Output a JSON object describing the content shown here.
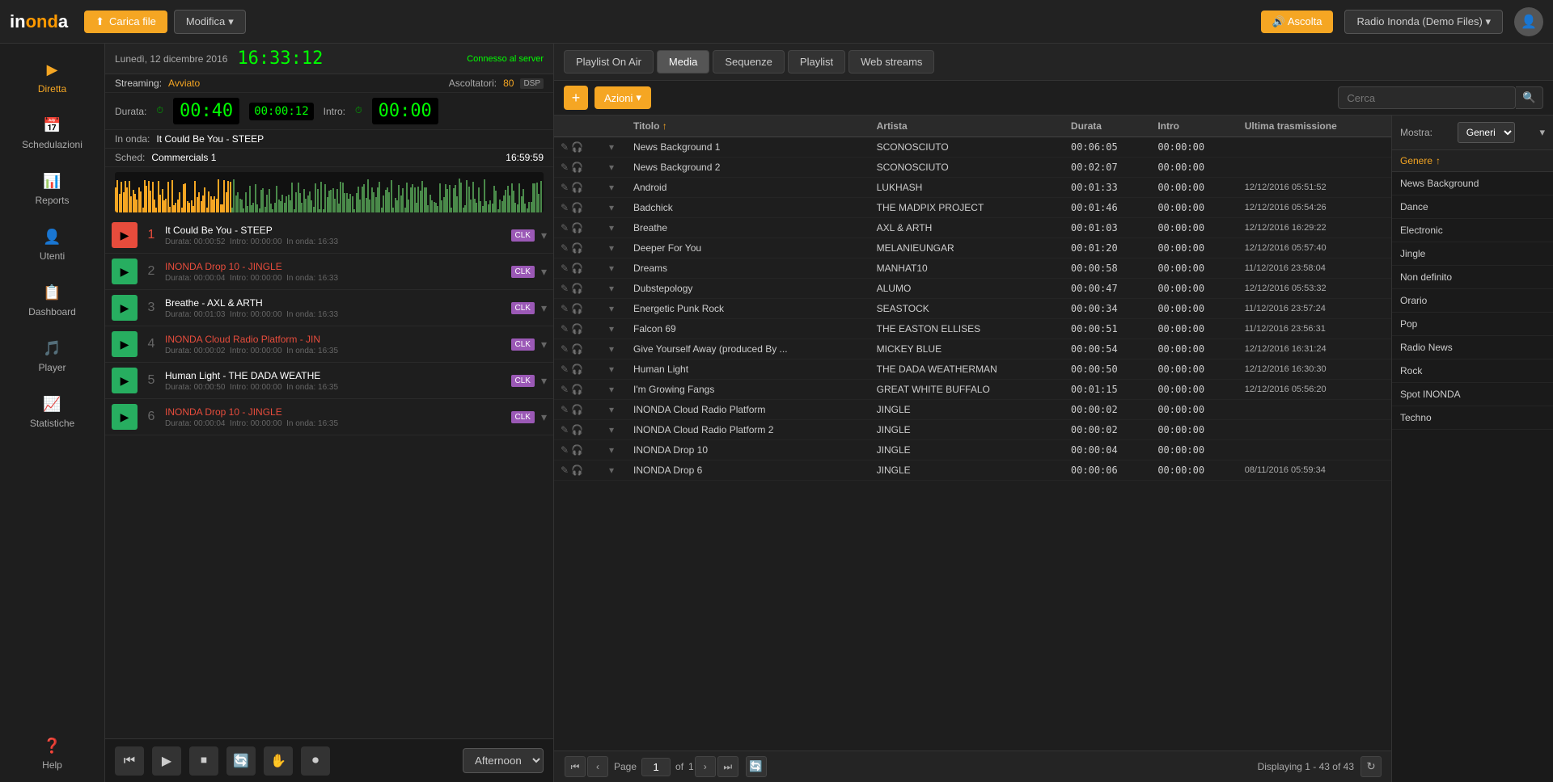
{
  "topbar": {
    "logo": "inonda",
    "carica_file": "Carica file",
    "modifica": "Modifica",
    "ascolta": "Ascolta",
    "radio_name": "Radio Inonda (Demo Files)"
  },
  "sidebar": {
    "items": [
      {
        "label": "Diretta",
        "icon": "▶"
      },
      {
        "label": "Schedulazioni",
        "icon": "📅"
      },
      {
        "label": "Reports",
        "icon": "📊"
      },
      {
        "label": "Utenti",
        "icon": "👤"
      },
      {
        "label": "Dashboard",
        "icon": "📋"
      },
      {
        "label": "Player",
        "icon": "🎵"
      },
      {
        "label": "Statistiche",
        "icon": "📈"
      },
      {
        "label": "Help",
        "icon": "?"
      }
    ]
  },
  "left_panel": {
    "date": "Lunedì, 12 dicembre 2016",
    "time": "16:33:12",
    "connected": "Connesso al server",
    "streaming_label": "Streaming:",
    "streaming_status": "Avviato",
    "listeners_label": "Ascoltatori:",
    "listeners_count": "80",
    "dsp": "DSP",
    "duration_label": "Durata:",
    "duration_main": "00:40",
    "duration_sub": "00:00:12",
    "intro_label": "Intro:",
    "intro_time": "00:00",
    "on_air_label": "In onda:",
    "on_air_title": "It Could Be You - STEEP",
    "sched_label": "Sched:",
    "sched_title": "Commercials 1",
    "sched_time": "16:59:59"
  },
  "playlist": {
    "items": [
      {
        "num": "1",
        "name": "It Could Be You - STEEP",
        "duration": "00:00:52",
        "intro": "00:00:00",
        "on_air": "16:33",
        "jingle": false,
        "active": true
      },
      {
        "num": "2",
        "name": "INONDA Drop 10 - JINGLE",
        "duration": "00:00:04",
        "intro": "00:00:00",
        "on_air": "16:33",
        "jingle": true,
        "active": false
      },
      {
        "num": "3",
        "name": "Breathe - AXL & ARTH",
        "duration": "00:01:03",
        "intro": "00:00:00",
        "on_air": "16:33",
        "jingle": false,
        "active": false
      },
      {
        "num": "4",
        "name": "INONDA Cloud Radio Platform - JIN",
        "duration": "00:00:02",
        "intro": "00:00:00",
        "on_air": "16:35",
        "jingle": true,
        "active": false
      },
      {
        "num": "5",
        "name": "Human Light - THE DADA WEATHE",
        "duration": "00:00:50",
        "intro": "00:00:00",
        "on_air": "16:35",
        "jingle": false,
        "active": false
      },
      {
        "num": "6",
        "name": "INONDA Drop 10 - JINGLE",
        "duration": "00:00:04",
        "intro": "00:00:00",
        "on_air": "16:35",
        "jingle": true,
        "active": false
      }
    ]
  },
  "controls": {
    "afternoon": "Afternoon"
  },
  "tabs": [
    {
      "label": "Playlist On Air",
      "active": false
    },
    {
      "label": "Media",
      "active": true
    },
    {
      "label": "Sequenze",
      "active": false
    },
    {
      "label": "Playlist",
      "active": false
    },
    {
      "label": "Web streams",
      "active": false
    }
  ],
  "toolbar": {
    "azioni_label": "Azioni",
    "search_placeholder": "Cerca"
  },
  "media_table": {
    "columns": [
      "",
      "",
      "Titolo",
      "Artista",
      "Durata",
      "Intro",
      "Ultima trasmissione"
    ],
    "rows": [
      {
        "title": "News Background 1",
        "artist": "SCONOSCIUTO",
        "duration": "00:06:05",
        "intro": "00:00:00",
        "last": "",
        "jingle": false
      },
      {
        "title": "News Background 2",
        "artist": "SCONOSCIUTO",
        "duration": "00:02:07",
        "intro": "00:00:00",
        "last": "",
        "jingle": false
      },
      {
        "title": "Android",
        "artist": "LUKHASH",
        "duration": "00:01:33",
        "intro": "00:00:00",
        "last": "12/12/2016 05:51:52",
        "jingle": false
      },
      {
        "title": "Badchick",
        "artist": "THE MADPIX PROJECT",
        "duration": "00:01:46",
        "intro": "00:00:00",
        "last": "12/12/2016 05:54:26",
        "jingle": false
      },
      {
        "title": "Breathe",
        "artist": "AXL & ARTH",
        "duration": "00:01:03",
        "intro": "00:00:00",
        "last": "12/12/2016 16:29:22",
        "jingle": false
      },
      {
        "title": "Deeper For You",
        "artist": "MELANIEUNGAR",
        "duration": "00:01:20",
        "intro": "00:00:00",
        "last": "12/12/2016 05:57:40",
        "jingle": false
      },
      {
        "title": "Dreams",
        "artist": "MANHAT10",
        "duration": "00:00:58",
        "intro": "00:00:00",
        "last": "11/12/2016 23:58:04",
        "jingle": false
      },
      {
        "title": "Dubstepology",
        "artist": "ALUMO",
        "duration": "00:00:47",
        "intro": "00:00:00",
        "last": "12/12/2016 05:53:32",
        "jingle": false
      },
      {
        "title": "Energetic Punk Rock",
        "artist": "SEASTOCK",
        "duration": "00:00:34",
        "intro": "00:00:00",
        "last": "11/12/2016 23:57:24",
        "jingle": false
      },
      {
        "title": "Falcon 69",
        "artist": "THE EASTON ELLISES",
        "duration": "00:00:51",
        "intro": "00:00:00",
        "last": "11/12/2016 23:56:31",
        "jingle": false
      },
      {
        "title": "Give Yourself Away (produced By ...",
        "artist": "MICKEY BLUE",
        "duration": "00:00:54",
        "intro": "00:00:00",
        "last": "12/12/2016 16:31:24",
        "jingle": false
      },
      {
        "title": "Human Light",
        "artist": "THE DADA WEATHERMAN",
        "duration": "00:00:50",
        "intro": "00:00:00",
        "last": "12/12/2016 16:30:30",
        "jingle": false
      },
      {
        "title": "I'm Growing Fangs",
        "artist": "GREAT WHITE BUFFALO",
        "duration": "00:01:15",
        "intro": "00:00:00",
        "last": "12/12/2016 05:56:20",
        "jingle": false
      },
      {
        "title": "INONDA Cloud Radio Platform",
        "artist": "JINGLE",
        "duration": "00:00:02",
        "intro": "00:00:00",
        "last": "",
        "jingle": true
      },
      {
        "title": "INONDA Cloud Radio Platform 2",
        "artist": "JINGLE",
        "duration": "00:00:02",
        "intro": "00:00:00",
        "last": "",
        "jingle": true
      },
      {
        "title": "INONDA Drop 10",
        "artist": "JINGLE",
        "duration": "00:00:04",
        "intro": "00:00:00",
        "last": "",
        "jingle": true
      },
      {
        "title": "INONDA Drop 6",
        "artist": "JINGLE",
        "duration": "00:00:06",
        "intro": "00:00:00",
        "last": "08/11/2016 05:59:34",
        "jingle": true
      }
    ]
  },
  "genre_panel": {
    "mostra_label": "Mostra:",
    "generi_label": "Generi",
    "col_label": "Genere",
    "genres": [
      "News Background",
      "Dance",
      "Electronic",
      "Jingle",
      "Non definito",
      "Orario",
      "Pop",
      "Radio News",
      "Rock",
      "Spot INONDA",
      "Techno"
    ]
  },
  "pagination": {
    "page_label": "Page",
    "page_num": "1",
    "of_label": "of",
    "total_pages": "1",
    "displaying": "Displaying 1 - 43 of 43"
  }
}
